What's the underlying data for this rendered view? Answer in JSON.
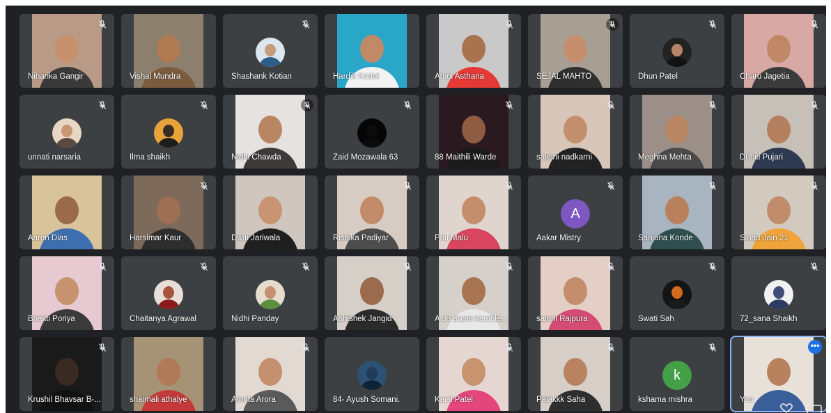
{
  "colors": {
    "background": "#202124",
    "tile": "#3c4043",
    "self_outline": "#8ab4f8",
    "more_button": "#1a73e8",
    "aakar_avatar": "#7e57c2",
    "kshama_avatar": "#43a047"
  },
  "self_tile_menu_label": "•••",
  "participants": [
    {
      "name": "Niharika Gangir",
      "kind": "video",
      "mic": "muted-icon",
      "bg": "#b89a86",
      "skin": "#c8916e",
      "cloth": "#3a3a3a"
    },
    {
      "name": "Vishal Mundra",
      "kind": "video",
      "mic": "none",
      "bg": "#8c7f6e",
      "skin": "#b07a52",
      "cloth": "#7a5c3e"
    },
    {
      "name": "Shashank Kotian",
      "kind": "avatar",
      "mic": "muted-icon",
      "skin": "#c79a7a",
      "cloth": "#2b5f8a",
      "abg": "#dbe7ef"
    },
    {
      "name": "Hardik Kadel",
      "kind": "video",
      "mic": "none",
      "bg": "#2aa6c9",
      "skin": "#c08a66",
      "cloth": "#f2f2f2"
    },
    {
      "name": "Amol Asthana",
      "kind": "video",
      "mic": "muted-icon",
      "bg": "#c9c9c9",
      "skin": "#a8734f",
      "cloth": "#e53935"
    },
    {
      "name": "SEJAL MAHTO",
      "kind": "video",
      "mic": "muted-bubble-icon",
      "bg": "#a89f94",
      "skin": "#c58e6d",
      "cloth": "#2f2f2f"
    },
    {
      "name": "Dhun Patel",
      "kind": "avatar",
      "mic": "muted-icon",
      "skin": "#b7866a",
      "cloth": "#111111",
      "abg": "#222222"
    },
    {
      "name": "Charu Jagetia",
      "kind": "video",
      "mic": "muted-icon",
      "bg": "#d8a9a4",
      "skin": "#c08866",
      "cloth": "#3b3b3b"
    },
    {
      "name": "unnati narsaria",
      "kind": "avatar",
      "mic": "muted-icon",
      "skin": "#c79672",
      "cloth": "#5b4a3f",
      "abg": "#e9d7c5"
    },
    {
      "name": "Ilma shaikh",
      "kind": "avatar",
      "mic": "muted-icon",
      "skin": "#3a2b22",
      "cloth": "#1c1c1c",
      "abg": "#e8a23a"
    },
    {
      "name": "Nidhi Chawda",
      "kind": "video",
      "mic": "muted-bubble-icon",
      "bg": "#e6e2df",
      "skin": "#b98563",
      "cloth": "#3d3a3a"
    },
    {
      "name": "Zaid Mozawala 63",
      "kind": "avatar",
      "mic": "muted-icon",
      "skin": "#0b0b0b",
      "cloth": "#0b0b0b",
      "abg": "#050505"
    },
    {
      "name": "88 Maithili Warde",
      "kind": "video",
      "mic": "muted-icon",
      "bg": "#2a1a1f",
      "skin": "#8f5b43",
      "cloth": "#1a1a1a"
    },
    {
      "name": "sakshi nadkarni",
      "kind": "video",
      "mic": "muted-icon",
      "bg": "#d9c6bb",
      "skin": "#c48f6d",
      "cloth": "#222222"
    },
    {
      "name": "Meghna Mehta",
      "kind": "video",
      "mic": "muted-icon",
      "bg": "#9b8f88",
      "skin": "#b98664",
      "cloth": "#4a4a4a"
    },
    {
      "name": "Duhiti Pujari",
      "kind": "video",
      "mic": "muted-icon",
      "bg": "#c7c0b8",
      "skin": "#b4805f",
      "cloth": "#2d3a52"
    },
    {
      "name": "Aaron Dias",
      "kind": "video",
      "mic": "none",
      "bg": "#d8c39a",
      "skin": "#9a6a4b",
      "cloth": "#3d6fb0"
    },
    {
      "name": "Harsimar Kaur",
      "kind": "video",
      "mic": "muted-icon",
      "bg": "#7d6a5a",
      "skin": "#9e6f52",
      "cloth": "#2e2e2e"
    },
    {
      "name": "Dwiti Jariwala",
      "kind": "video",
      "mic": "none",
      "bg": "#cfc7bf",
      "skin": "#c99472",
      "cloth": "#1f1f1f"
    },
    {
      "name": "Rishika Padiyar",
      "kind": "video",
      "mic": "muted-icon",
      "bg": "#d7ccc4",
      "skin": "#c28c6a",
      "cloth": "#4d4d4d"
    },
    {
      "name": "Priti Malu",
      "kind": "video",
      "mic": "muted-icon",
      "bg": "#e0d4cf",
      "skin": "#c48d6c",
      "cloth": "#d9455f"
    },
    {
      "name": "Aakar Mistry",
      "kind": "letter",
      "letter": "A",
      "mic": "muted-icon",
      "abg": "#7e57c2"
    },
    {
      "name": "Sanjana Konde",
      "kind": "video",
      "mic": "muted-icon",
      "bg": "#a8b4c0",
      "skin": "#b8805d",
      "cloth": "#2f4f4f"
    },
    {
      "name": "Sload Jain 21",
      "kind": "video",
      "mic": "muted-icon",
      "bg": "#d2c9bf",
      "skin": "#c08c6a",
      "cloth": "#f0a33a"
    },
    {
      "name": "Bhakti Poriya",
      "kind": "video",
      "mic": "muted-icon",
      "bg": "#e7c9d2",
      "skin": "#c7936f",
      "cloth": "#3a3a3a"
    },
    {
      "name": "Chaitanya Agrawal",
      "kind": "avatar",
      "mic": "muted-icon",
      "skin": "#a8543d",
      "cloth": "#8b1a1a",
      "abg": "#e7dfd7"
    },
    {
      "name": "Nidhi Panday",
      "kind": "avatar",
      "mic": "muted-icon",
      "skin": "#c68f6e",
      "cloth": "#5a8f3c",
      "abg": "#e6dccd"
    },
    {
      "name": "Abhishek Jangid",
      "kind": "video",
      "mic": "muted-icon",
      "bg": "#d5cfc8",
      "skin": "#9c6b4d",
      "cloth": "#2b2b2b"
    },
    {
      "name": "A 38 aryan kamble...",
      "kind": "video",
      "mic": "muted-icon",
      "bg": "#d6d0ca",
      "skin": "#a97452",
      "cloth": "#e8e8e8"
    },
    {
      "name": "saloni Rajpura",
      "kind": "video",
      "mic": "muted-icon",
      "bg": "#e3cfc6",
      "skin": "#c48d6b",
      "cloth": "#d44c73"
    },
    {
      "name": "Swati Sah",
      "kind": "avatar",
      "mic": "muted-icon",
      "skin": "#d36b1f",
      "cloth": "#1a1a1a",
      "abg": "#141414"
    },
    {
      "name": "72_sana Shaikh",
      "kind": "avatar",
      "mic": "muted-icon",
      "skin": "#3f4f7a",
      "cloth": "#2c3b63",
      "abg": "#f1f1f1"
    },
    {
      "name": "Krushil Bhavsar B-...",
      "kind": "video",
      "mic": "muted-icon",
      "bg": "#1a1a1a",
      "skin": "#3b2a22",
      "cloth": "#111111"
    },
    {
      "name": "shaimali athalye",
      "kind": "video",
      "mic": "none",
      "bg": "#a69275",
      "skin": "#b07a58",
      "cloth": "#c43a3a"
    },
    {
      "name": "Amrita Arora",
      "kind": "video",
      "mic": "muted-icon",
      "bg": "#e2d9d3",
      "skin": "#c5906e",
      "cloth": "#5a5a5a"
    },
    {
      "name": "84- Ayush Somani.",
      "kind": "avatar",
      "mic": "none",
      "skin": "#1f3b5a",
      "cloth": "#0e2238",
      "abg": "#2d5173"
    },
    {
      "name": "Kajal Patel",
      "kind": "video",
      "mic": "muted-icon",
      "bg": "#e5d6d2",
      "skin": "#c8936f",
      "cloth": "#e2467a"
    },
    {
      "name": "Palakkk Saha",
      "kind": "video",
      "mic": "muted-icon",
      "bg": "#d6cec7",
      "skin": "#b98260",
      "cloth": "#2e2e2e"
    },
    {
      "name": "kshama mishra",
      "kind": "letter",
      "letter": "k",
      "mic": "muted-icon",
      "abg": "#43a047"
    },
    {
      "name": "You",
      "kind": "video",
      "mic": "none",
      "self": true,
      "bg": "#e8e1da",
      "skin": "#b9825f",
      "cloth": "#3a5f9a"
    }
  ]
}
